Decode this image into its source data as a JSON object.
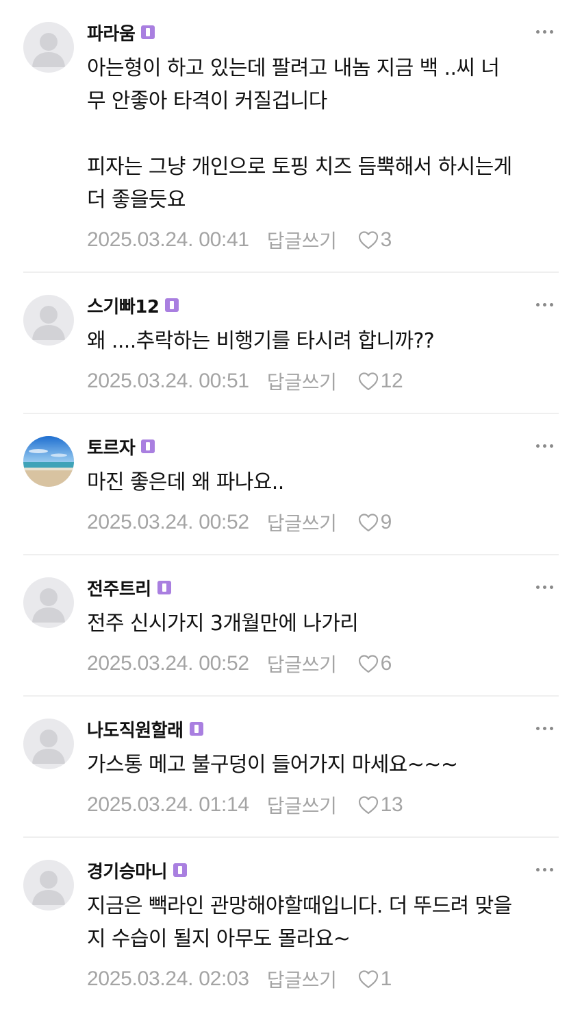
{
  "comments": [
    {
      "author": "파라움",
      "badge": "1",
      "text": "아는형이 하고 있는데 팔려고 내놈 지금 백 ..씨 너\n무 안좋아 타격이 커질겁니다\n\n피자는 그냥 개인으로 토핑 치즈 듬뿍해서 하시는게\n더 좋을듯요",
      "date": "2025.03.24. 00:41",
      "reply_label": "답글쓰기",
      "likes": "3",
      "avatar": "default"
    },
    {
      "author": "스기빠12",
      "badge": "1",
      "text": "왜 ....추락하는 비행기를 타시려 합니까??",
      "date": "2025.03.24. 00:51",
      "reply_label": "답글쓰기",
      "likes": "12",
      "avatar": "default"
    },
    {
      "author": "토르자",
      "badge": "1",
      "text": "마진 좋은데 왜 파나요..",
      "date": "2025.03.24. 00:52",
      "reply_label": "답글쓰기",
      "likes": "9",
      "avatar": "beach-photo"
    },
    {
      "author": "전주트리",
      "badge": "1",
      "text": "전주 신시가지 3개월만에 나가리",
      "date": "2025.03.24. 00:52",
      "reply_label": "답글쓰기",
      "likes": "6",
      "avatar": "default"
    },
    {
      "author": "나도직원할래",
      "badge": "1",
      "text": "가스통 메고 불구덩이 들어가지 마세요~~~",
      "date": "2025.03.24. 01:14",
      "reply_label": "답글쓰기",
      "likes": "13",
      "avatar": "default"
    },
    {
      "author": "경기승마니",
      "badge": "1",
      "text": "지금은 빽라인 관망해야할때입니다. 더 뚜드려 맞을\n지 수습이 될지 아무도 몰라요~",
      "date": "2025.03.24. 02:03",
      "reply_label": "답글쓰기",
      "likes": "1",
      "avatar": "default"
    }
  ],
  "colors": {
    "badge": "#a97fe0",
    "meta_text": "#a4a4a4",
    "divider": "#efefef",
    "avatar_bg": "#e9e9ec"
  }
}
